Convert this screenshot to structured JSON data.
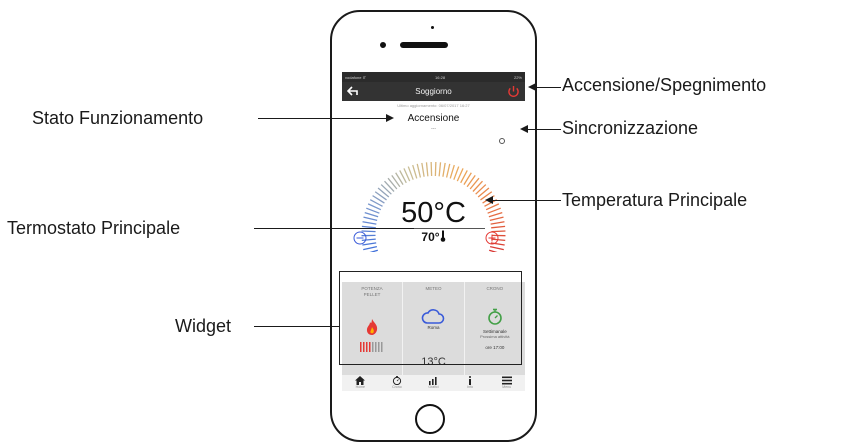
{
  "annotations": {
    "power": "Accensione/Spegnimento",
    "state": "Stato Funzionamento",
    "sync": "Sincronizzazione",
    "main_temp": "Temperatura Principale",
    "thermostat": "Termostato Principale",
    "widget": "Widget"
  },
  "status_bar": {
    "carrier": "vodafone IT",
    "time": "16:28",
    "battery": "22%"
  },
  "header": {
    "title": "Soggiorno",
    "last_sync": "Ultimo aggiornamento: 06/07/2017 16:27"
  },
  "stove": {
    "state": "Accensione",
    "state_sub": "---",
    "temperature": "50°C",
    "setpoint": "70°"
  },
  "widgets": {
    "pellet": {
      "title": "POTENZA PELLET"
    },
    "meteo": {
      "title": "METEO",
      "city": "Roma",
      "temp": "13°C"
    },
    "crono": {
      "title": "CRONO",
      "mode": "Settimanale",
      "next": "Prossima attività",
      "time": "ore 17:00"
    }
  },
  "nav": [
    {
      "label": "Home",
      "icon": "home-icon"
    },
    {
      "label": "Crono",
      "icon": "timer-icon"
    },
    {
      "label": "Grafici",
      "icon": "chart-icon"
    },
    {
      "label": "Info",
      "icon": "info-icon"
    },
    {
      "label": "Menu",
      "icon": "menu-icon"
    }
  ],
  "colors": {
    "accent_red": "#e53935",
    "accent_blue": "#3a5bd9",
    "accent_green": "#43a047"
  }
}
